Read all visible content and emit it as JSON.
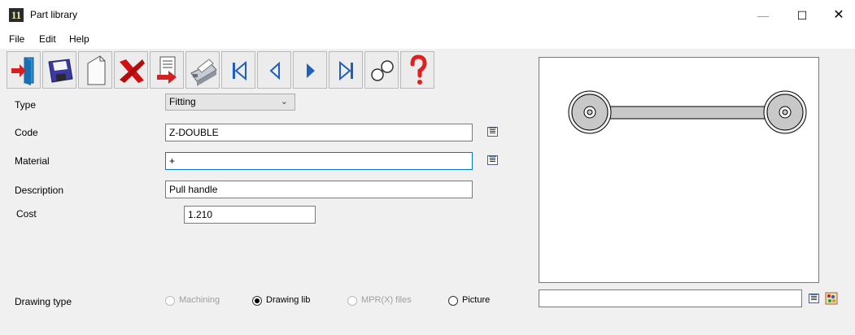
{
  "window": {
    "app_icon_text": "11",
    "title": "Part library",
    "minimize": "—",
    "maximize": "☐",
    "close": "✕"
  },
  "menu": {
    "file": "File",
    "edit": "Edit",
    "help": "Help"
  },
  "toolbar": {
    "buttons": [
      "exit-icon",
      "save-icon",
      "new-document-icon",
      "delete-icon",
      "export-icon",
      "print-icon",
      "first-record-icon",
      "previous-record-icon",
      "next-record-icon",
      "last-record-icon",
      "search-icon",
      "help-icon"
    ]
  },
  "form": {
    "type_label": "Type",
    "type_value": "Fitting",
    "code_label": "Code",
    "code_value": "Z-DOUBLE",
    "material_label": "Material",
    "material_value": "+",
    "description_label": "Description",
    "description_value": "Pull handle",
    "cost_label": "Cost",
    "cost_value": "1.210",
    "drawing_type_label": "Drawing type"
  },
  "drawing_type": {
    "options": [
      {
        "label": "Machining",
        "enabled": false,
        "selected": false
      },
      {
        "label": "Drawing lib",
        "enabled": true,
        "selected": true
      },
      {
        "label": "MPR(X) files",
        "enabled": false,
        "selected": false
      },
      {
        "label": "Picture",
        "enabled": true,
        "selected": false
      }
    ]
  },
  "preview": {
    "path_value": ""
  },
  "colors": {
    "focus_border": "#0078d7",
    "nav_blue": "#1f5fbf",
    "delete_red": "#d01010",
    "help_red": "#e02020"
  }
}
